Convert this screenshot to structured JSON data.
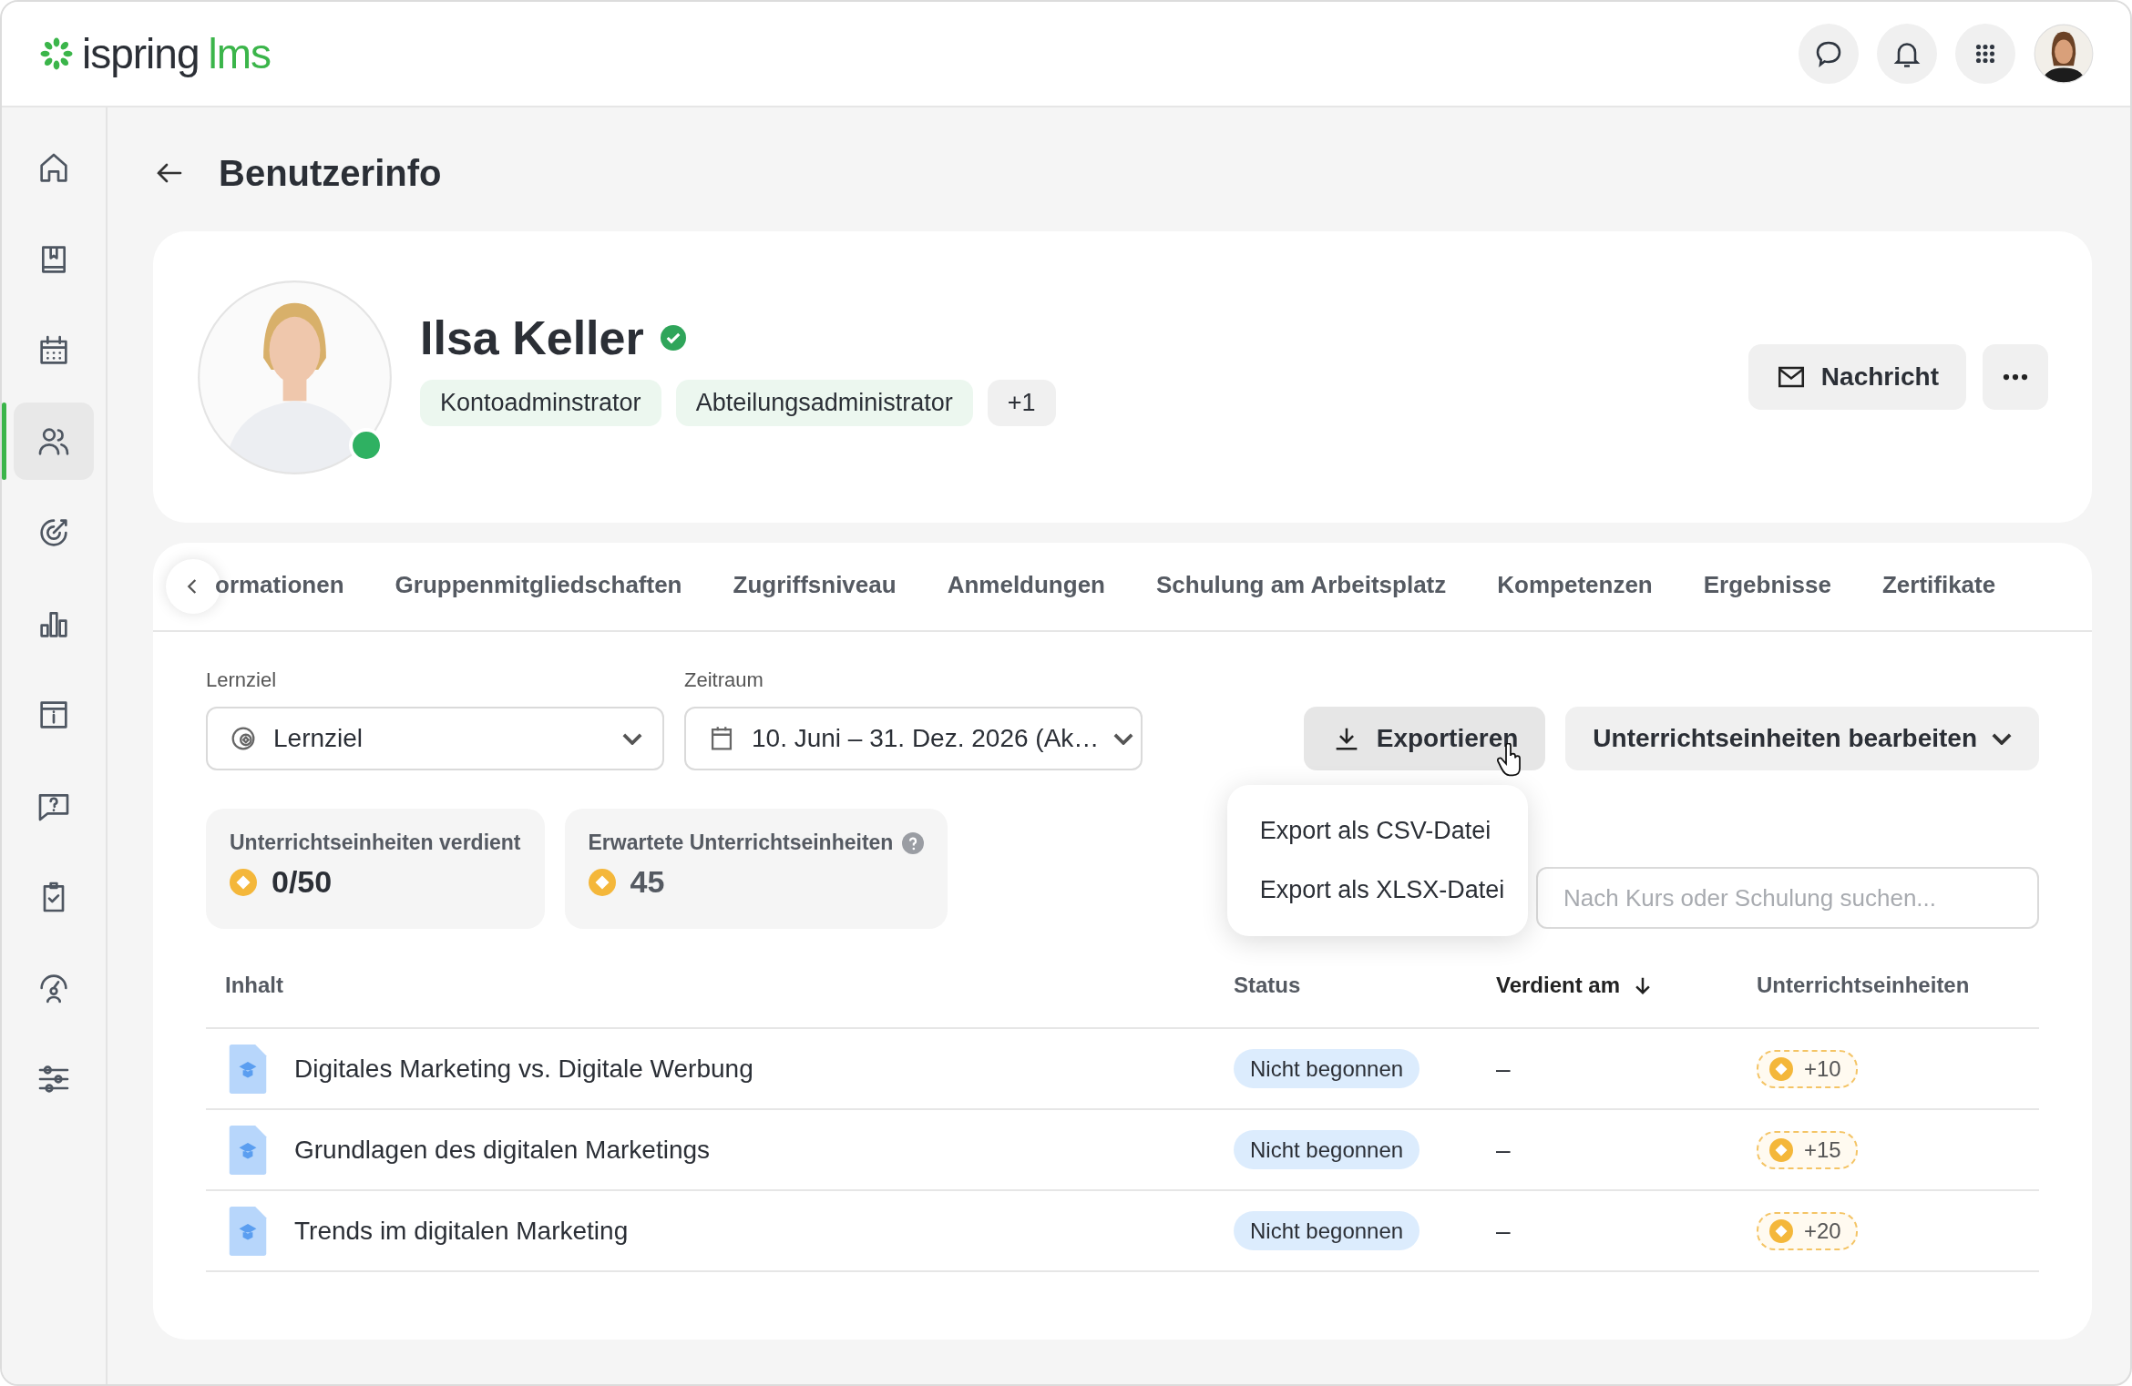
{
  "header": {
    "logo": {
      "name": "ispring",
      "suffix": "lms"
    }
  },
  "sidebar": {
    "items": [
      {
        "selected": false
      },
      {
        "selected": false
      },
      {
        "selected": false
      },
      {
        "selected": true
      },
      {
        "selected": false
      },
      {
        "selected": false
      },
      {
        "selected": false
      },
      {
        "selected": false
      },
      {
        "selected": false
      },
      {
        "selected": false
      },
      {
        "selected": false
      }
    ]
  },
  "page": {
    "title": "Benutzerinfo"
  },
  "profile": {
    "name": "Ilsa Keller",
    "verified": true,
    "online": true,
    "roles": [
      {
        "label": "Kontoadminstrator",
        "kind": "role"
      },
      {
        "label": "Abteilungsadministrator",
        "kind": "role"
      },
      {
        "label": "+1",
        "kind": "more"
      }
    ],
    "message_button": "Nachricht"
  },
  "tabs": [
    {
      "label": "ormationen",
      "selected": false
    },
    {
      "label": "Gruppenmitgliedschaften",
      "selected": false
    },
    {
      "label": "Zugriffsniveau",
      "selected": false
    },
    {
      "label": "Anmeldungen",
      "selected": false
    },
    {
      "label": "Schulung am Arbeitsplatz",
      "selected": false
    },
    {
      "label": "Kompetenzen",
      "selected": false
    },
    {
      "label": "Ergebnisse",
      "selected": false
    },
    {
      "label": "Zertifikate",
      "selected": false
    }
  ],
  "filters": [
    {
      "label": "Lernziel",
      "value": "Lernziel"
    },
    {
      "label": "Zeitraum",
      "value": "10. Juni – 31. Dez. 2026 (Ak…"
    }
  ],
  "actions": {
    "export": "Exportieren",
    "edit": "Unterrichtseinheiten bearbeiten"
  },
  "export_menu": [
    "Export als CSV-Datei",
    "Export als XLSX-Datei"
  ],
  "stats": [
    {
      "label": "Unterrichtseinheiten verdient",
      "value": "0/50",
      "help": false
    },
    {
      "label": "Erwartete Unterrichtseinheiten",
      "value": "45",
      "help": true
    }
  ],
  "search": {
    "placeholder": "Nach Kurs oder Schulung suchen..."
  },
  "table": {
    "columns": [
      {
        "label": "Inhalt",
        "sorted": false
      },
      {
        "label": "Status",
        "sorted": false
      },
      {
        "label": "Verdient am",
        "sorted": true
      },
      {
        "label": "Unterrichtseinheiten",
        "sorted": false
      }
    ],
    "rows": [
      {
        "title": "Digitales Marketing vs. Digitale Werbung",
        "status": "Nicht begonnen",
        "earned": "–",
        "units": "+10"
      },
      {
        "title": "Grundlagen des digitalen Marketings",
        "status": "Nicht begonnen",
        "earned": "–",
        "units": "+15"
      },
      {
        "title": "Trends im digitalen Marketing",
        "status": "Nicht begonnen",
        "earned": "–",
        "units": "+20"
      }
    ]
  }
}
